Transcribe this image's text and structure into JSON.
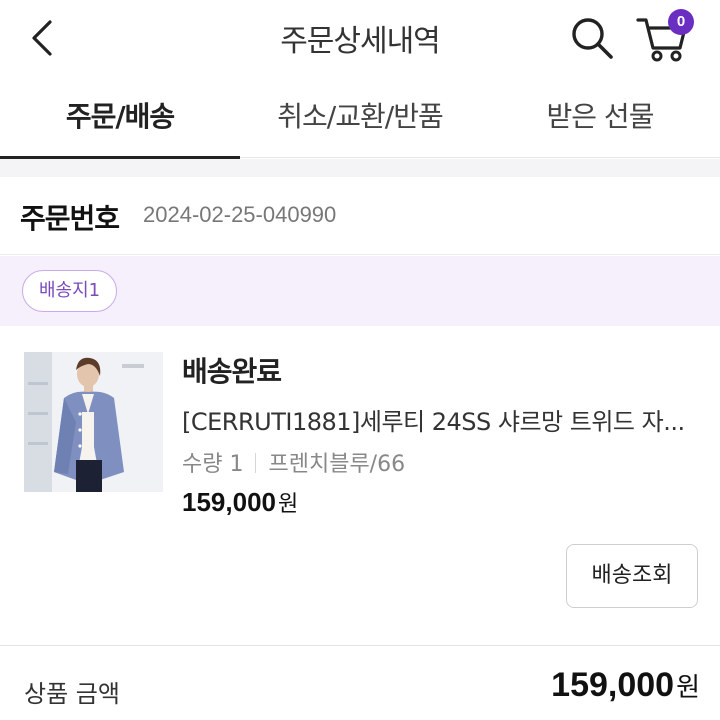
{
  "header": {
    "title": "주문상세내역",
    "back_icon": "chevron-left-icon",
    "search_icon": "search-icon",
    "cart_icon": "cart-icon",
    "cart_count": "0",
    "accent_color": "#6a2ec2"
  },
  "tabs": [
    {
      "label": "주문/배송",
      "active": true
    },
    {
      "label": "취소/교환/반품",
      "active": false
    },
    {
      "label": "받은 선물",
      "active": false
    }
  ],
  "order": {
    "label": "주문번호",
    "number": "2024-02-25-040990"
  },
  "destination": {
    "chip_label": "배송지1"
  },
  "product": {
    "status": "배송완료",
    "name": "[CERRUTI1881]세루티 24SS 샤르망 트위드 자...",
    "quantity": "수량 1",
    "option": "프렌치블루/66",
    "price": "159,000",
    "currency": "원",
    "track_button": "배송조회"
  },
  "summary": {
    "label": "상품 금액",
    "amount": "159,000",
    "currency": "원"
  }
}
